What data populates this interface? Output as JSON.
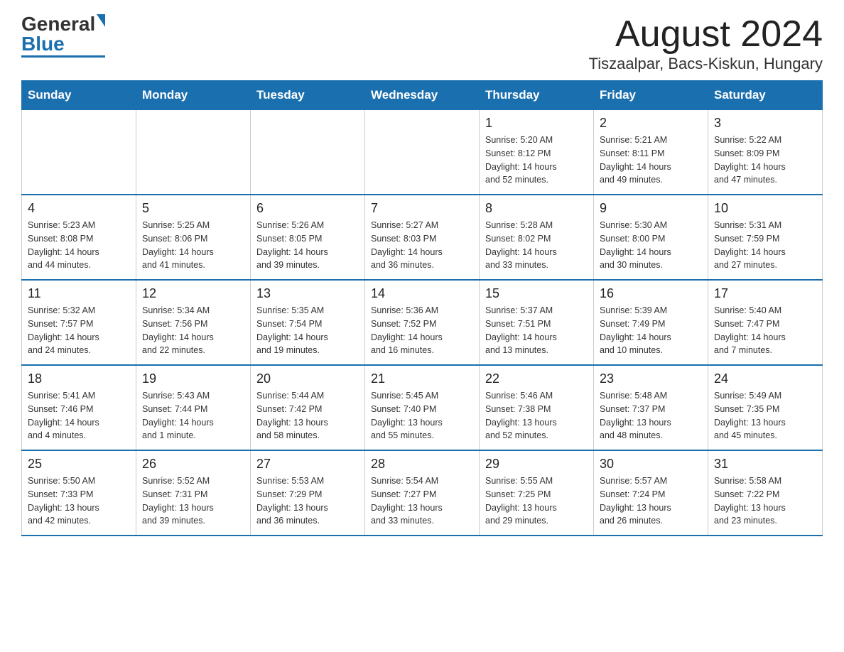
{
  "header": {
    "logo_general": "General",
    "logo_blue": "Blue",
    "month_title": "August 2024",
    "location": "Tiszaalpar, Bacs-Kiskun, Hungary"
  },
  "days_of_week": [
    "Sunday",
    "Monday",
    "Tuesday",
    "Wednesday",
    "Thursday",
    "Friday",
    "Saturday"
  ],
  "weeks": [
    {
      "days": [
        {
          "number": "",
          "info": ""
        },
        {
          "number": "",
          "info": ""
        },
        {
          "number": "",
          "info": ""
        },
        {
          "number": "",
          "info": ""
        },
        {
          "number": "1",
          "info": "Sunrise: 5:20 AM\nSunset: 8:12 PM\nDaylight: 14 hours\nand 52 minutes."
        },
        {
          "number": "2",
          "info": "Sunrise: 5:21 AM\nSunset: 8:11 PM\nDaylight: 14 hours\nand 49 minutes."
        },
        {
          "number": "3",
          "info": "Sunrise: 5:22 AM\nSunset: 8:09 PM\nDaylight: 14 hours\nand 47 minutes."
        }
      ]
    },
    {
      "days": [
        {
          "number": "4",
          "info": "Sunrise: 5:23 AM\nSunset: 8:08 PM\nDaylight: 14 hours\nand 44 minutes."
        },
        {
          "number": "5",
          "info": "Sunrise: 5:25 AM\nSunset: 8:06 PM\nDaylight: 14 hours\nand 41 minutes."
        },
        {
          "number": "6",
          "info": "Sunrise: 5:26 AM\nSunset: 8:05 PM\nDaylight: 14 hours\nand 39 minutes."
        },
        {
          "number": "7",
          "info": "Sunrise: 5:27 AM\nSunset: 8:03 PM\nDaylight: 14 hours\nand 36 minutes."
        },
        {
          "number": "8",
          "info": "Sunrise: 5:28 AM\nSunset: 8:02 PM\nDaylight: 14 hours\nand 33 minutes."
        },
        {
          "number": "9",
          "info": "Sunrise: 5:30 AM\nSunset: 8:00 PM\nDaylight: 14 hours\nand 30 minutes."
        },
        {
          "number": "10",
          "info": "Sunrise: 5:31 AM\nSunset: 7:59 PM\nDaylight: 14 hours\nand 27 minutes."
        }
      ]
    },
    {
      "days": [
        {
          "number": "11",
          "info": "Sunrise: 5:32 AM\nSunset: 7:57 PM\nDaylight: 14 hours\nand 24 minutes."
        },
        {
          "number": "12",
          "info": "Sunrise: 5:34 AM\nSunset: 7:56 PM\nDaylight: 14 hours\nand 22 minutes."
        },
        {
          "number": "13",
          "info": "Sunrise: 5:35 AM\nSunset: 7:54 PM\nDaylight: 14 hours\nand 19 minutes."
        },
        {
          "number": "14",
          "info": "Sunrise: 5:36 AM\nSunset: 7:52 PM\nDaylight: 14 hours\nand 16 minutes."
        },
        {
          "number": "15",
          "info": "Sunrise: 5:37 AM\nSunset: 7:51 PM\nDaylight: 14 hours\nand 13 minutes."
        },
        {
          "number": "16",
          "info": "Sunrise: 5:39 AM\nSunset: 7:49 PM\nDaylight: 14 hours\nand 10 minutes."
        },
        {
          "number": "17",
          "info": "Sunrise: 5:40 AM\nSunset: 7:47 PM\nDaylight: 14 hours\nand 7 minutes."
        }
      ]
    },
    {
      "days": [
        {
          "number": "18",
          "info": "Sunrise: 5:41 AM\nSunset: 7:46 PM\nDaylight: 14 hours\nand 4 minutes."
        },
        {
          "number": "19",
          "info": "Sunrise: 5:43 AM\nSunset: 7:44 PM\nDaylight: 14 hours\nand 1 minute."
        },
        {
          "number": "20",
          "info": "Sunrise: 5:44 AM\nSunset: 7:42 PM\nDaylight: 13 hours\nand 58 minutes."
        },
        {
          "number": "21",
          "info": "Sunrise: 5:45 AM\nSunset: 7:40 PM\nDaylight: 13 hours\nand 55 minutes."
        },
        {
          "number": "22",
          "info": "Sunrise: 5:46 AM\nSunset: 7:38 PM\nDaylight: 13 hours\nand 52 minutes."
        },
        {
          "number": "23",
          "info": "Sunrise: 5:48 AM\nSunset: 7:37 PM\nDaylight: 13 hours\nand 48 minutes."
        },
        {
          "number": "24",
          "info": "Sunrise: 5:49 AM\nSunset: 7:35 PM\nDaylight: 13 hours\nand 45 minutes."
        }
      ]
    },
    {
      "days": [
        {
          "number": "25",
          "info": "Sunrise: 5:50 AM\nSunset: 7:33 PM\nDaylight: 13 hours\nand 42 minutes."
        },
        {
          "number": "26",
          "info": "Sunrise: 5:52 AM\nSunset: 7:31 PM\nDaylight: 13 hours\nand 39 minutes."
        },
        {
          "number": "27",
          "info": "Sunrise: 5:53 AM\nSunset: 7:29 PM\nDaylight: 13 hours\nand 36 minutes."
        },
        {
          "number": "28",
          "info": "Sunrise: 5:54 AM\nSunset: 7:27 PM\nDaylight: 13 hours\nand 33 minutes."
        },
        {
          "number": "29",
          "info": "Sunrise: 5:55 AM\nSunset: 7:25 PM\nDaylight: 13 hours\nand 29 minutes."
        },
        {
          "number": "30",
          "info": "Sunrise: 5:57 AM\nSunset: 7:24 PM\nDaylight: 13 hours\nand 26 minutes."
        },
        {
          "number": "31",
          "info": "Sunrise: 5:58 AM\nSunset: 7:22 PM\nDaylight: 13 hours\nand 23 minutes."
        }
      ]
    }
  ]
}
